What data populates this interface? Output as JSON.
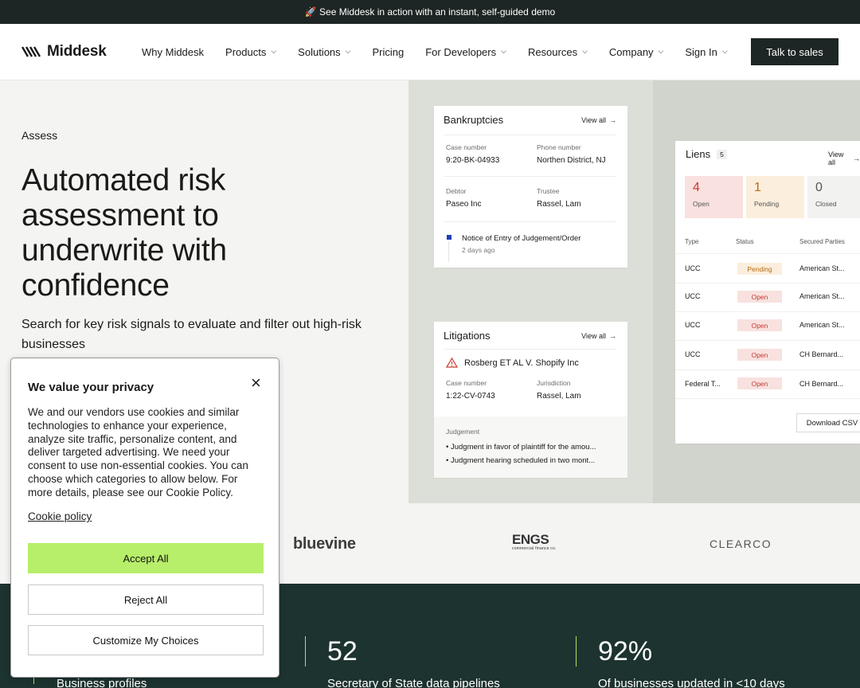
{
  "banner": {
    "icon": "rocket-icon",
    "text": "🚀 See Middesk in action with an instant, self-guided demo"
  },
  "nav": {
    "logo": "Middesk",
    "items": [
      {
        "label": "Why Middesk",
        "dropdown": false
      },
      {
        "label": "Products",
        "dropdown": true
      },
      {
        "label": "Solutions",
        "dropdown": true
      },
      {
        "label": "Pricing",
        "dropdown": false
      },
      {
        "label": "For Developers",
        "dropdown": true
      },
      {
        "label": "Resources",
        "dropdown": true
      },
      {
        "label": "Company",
        "dropdown": true
      },
      {
        "label": "Sign In",
        "dropdown": true
      }
    ],
    "cta": "Talk to sales"
  },
  "hero": {
    "eyebrow": "Assess",
    "title": "Automated risk assessment to underwrite with confidence",
    "subtitle": "Search for key risk signals to evaluate and filter out high-risk businesses"
  },
  "bankruptcies": {
    "title": "Bankruptcies",
    "view_all": "View all",
    "case_number_label": "Case number",
    "case_number": "9:20-BK-04933",
    "phone_label": "Phone number",
    "phone": "Northen District, NJ",
    "debtor_label": "Debtor",
    "debtor": "Paseo Inc",
    "trustee_label": "Trustee",
    "trustee": "Rassel, Lam",
    "event": "Notice of Entry of Judgement/Order",
    "event_time": "2 days ago"
  },
  "litigations": {
    "title": "Litigations",
    "view_all": "View all",
    "case_title": "Rosberg ET AL V. Shopify Inc",
    "case_number_label": "Case number",
    "case_number": "1:22-CV-0743",
    "jurisdiction_label": "Jurisdiction",
    "jurisdiction": "Rassel, Lam",
    "judgement_label": "Judgement",
    "judgements": [
      "Judgment in favor of plaintiff for the amou...",
      "Judgment hearing scheduled in two mont..."
    ]
  },
  "liens": {
    "title": "Liens",
    "count": "5",
    "view_all": "View all",
    "stats": [
      {
        "num": "4",
        "label": "Open",
        "bg": "#f8e1df",
        "color": "#c73a30"
      },
      {
        "num": "1",
        "label": "Pending",
        "bg": "#fbeedc",
        "color": "#b86a16"
      },
      {
        "num": "0",
        "label": "Closed",
        "bg": "#f2f2f0",
        "color": "#555555"
      }
    ],
    "headers": {
      "type": "Type",
      "status": "Status",
      "parties": "Secured Parties"
    },
    "rows": [
      {
        "type": "UCC",
        "status": "Pending",
        "party": "American St..."
      },
      {
        "type": "UCC",
        "status": "Open",
        "party": "American St..."
      },
      {
        "type": "UCC",
        "status": "Open",
        "party": "American St..."
      },
      {
        "type": "UCC",
        "status": "Open",
        "party": "CH Bernard..."
      },
      {
        "type": "Federal T...",
        "status": "Open",
        "party": "CH Bernard..."
      }
    ],
    "download": "Download CSV"
  },
  "logos": {
    "bluevine": "bluevine",
    "engs": "ENGS",
    "engs_sub": "commercial finance co.",
    "clearco": "CLEARCO"
  },
  "stats": [
    {
      "value": "",
      "caption": "Business profiles"
    },
    {
      "value": "52",
      "caption": "Secretary of State data pipelines"
    },
    {
      "value": "92%",
      "caption": "Of businesses updated in <10 days"
    }
  ],
  "privacy": {
    "title": "We value your privacy",
    "body": "We and our vendors use cookies and similar technologies to enhance your experience, analyze site traffic, personalize content, and deliver targeted advertising. We need your consent to use non-essential cookies. You can choose which categories to allow below. For more details, please see our Cookie Policy.",
    "link": "Cookie policy",
    "accept": "Accept All",
    "reject": "Reject All",
    "customize": "Customize My Choices",
    "close_icon": "close-icon"
  },
  "colors": {
    "dark": "#1d2624",
    "stats_bg": "#1d3330",
    "accent_green": "#b7ee6a",
    "open_red": "#c73a30",
    "pending_orange": "#b86a16"
  }
}
